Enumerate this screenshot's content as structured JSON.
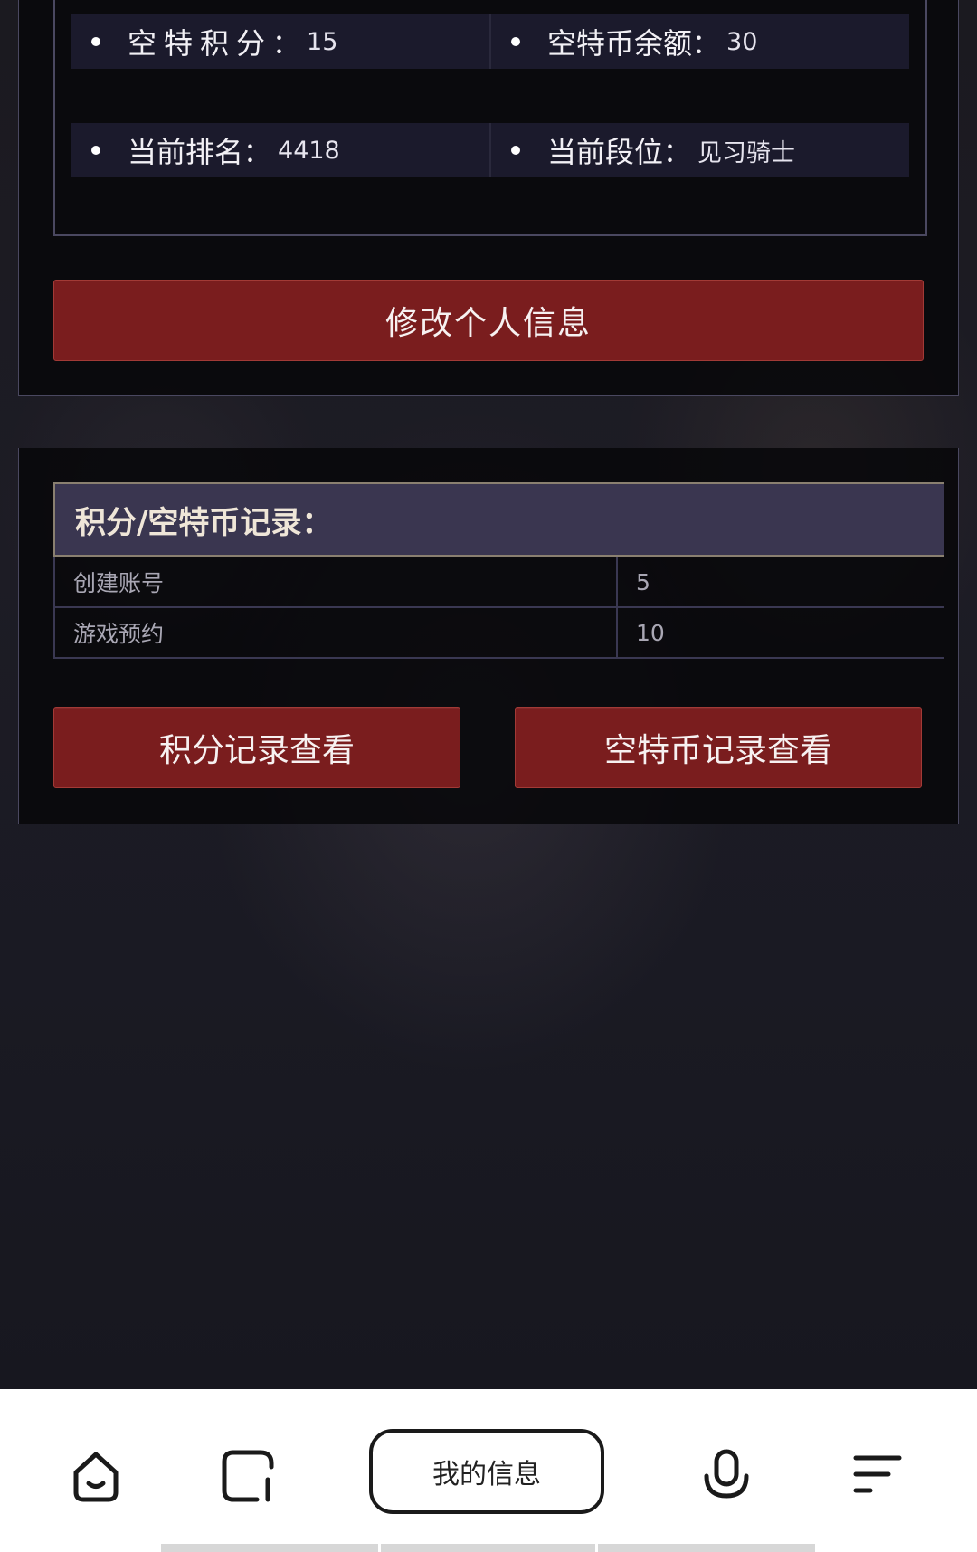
{
  "profile": {
    "stats": [
      {
        "label": "空特积分",
        "value": "15"
      },
      {
        "label": "空特币余额",
        "value": "30"
      },
      {
        "label": "当前排名",
        "value": "4418"
      },
      {
        "label": "当前段位",
        "value": "见习骑士"
      }
    ],
    "colon": "：",
    "edit_button_label": "修改个人信息"
  },
  "records": {
    "title": "积分/空特币记录：",
    "rows": [
      {
        "name": "创建账号",
        "value": "5"
      },
      {
        "name": "游戏预约",
        "value": "10"
      }
    ],
    "points_button_label": "积分记录查看",
    "coins_button_label": "空特币记录查看"
  },
  "bottom_nav": {
    "items": [
      {
        "icon": "home-icon"
      },
      {
        "icon": "card-icon"
      },
      {
        "label": "我的信息"
      },
      {
        "icon": "microphone-icon"
      },
      {
        "icon": "menu-icon"
      }
    ]
  },
  "colors": {
    "button_red": "#7a1d1e",
    "header_purple": "#3a3650",
    "panel_bg": "#08080a",
    "cell_bg": "#1b1a2c"
  }
}
